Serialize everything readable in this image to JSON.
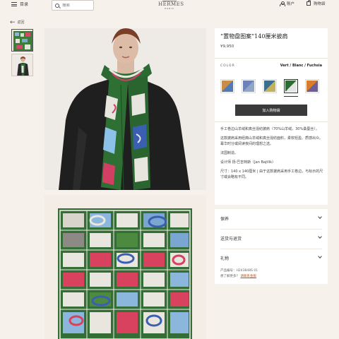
{
  "header": {
    "menu_label": "目录",
    "search_placeholder": "搜索",
    "logo_name": "HERMES",
    "logo_city": "PARIS",
    "account_label": "账户",
    "cart_label": "购物袋"
  },
  "nav": {
    "back_label": "返回"
  },
  "product": {
    "title": "“置物盘图案”140厘米披肩",
    "price": "¥9,950",
    "color_label": "COLOR",
    "color_value": "Vert / Blanc / Fuchsia",
    "add_to_bag": "加入购物袋",
    "description": [
      "手工卷边山羊绒和真丝混纺披肩（70%山羊绒，30%桑蚕丝）。",
      "这款披肩采用经典山羊绒和真丝混纺面料，柔软轻盈、质感出众。幕华时分或阅读夜间的理想之选。",
      "法国制造。",
      "设计师 扬·巴吉特斯（Jan Bajtlik）",
      "尺寸：140 x 140厘米 | 由于这款披肩采用手工卷边，与标示的尺寸或会略有不同。"
    ]
  },
  "swatches": [
    {
      "colors": [
        "#c68d4c",
        "#4f7ab8"
      ]
    },
    {
      "colors": [
        "#6c82b8",
        "#8fa6c9"
      ]
    },
    {
      "colors": [
        "#3c6f8f",
        "#c4b25a"
      ]
    },
    {
      "colors": [
        "#2f6b35",
        "#e4e4e4"
      ]
    },
    {
      "colors": [
        "#d97c2c",
        "#6f5d9a"
      ]
    }
  ],
  "accordion": {
    "items": [
      "保养",
      "送货与退货",
      "礼物"
    ],
    "product_id_label": "产品编号：H243848S 01",
    "help_text": "想了解更多？",
    "help_link": "请联系金服"
  }
}
